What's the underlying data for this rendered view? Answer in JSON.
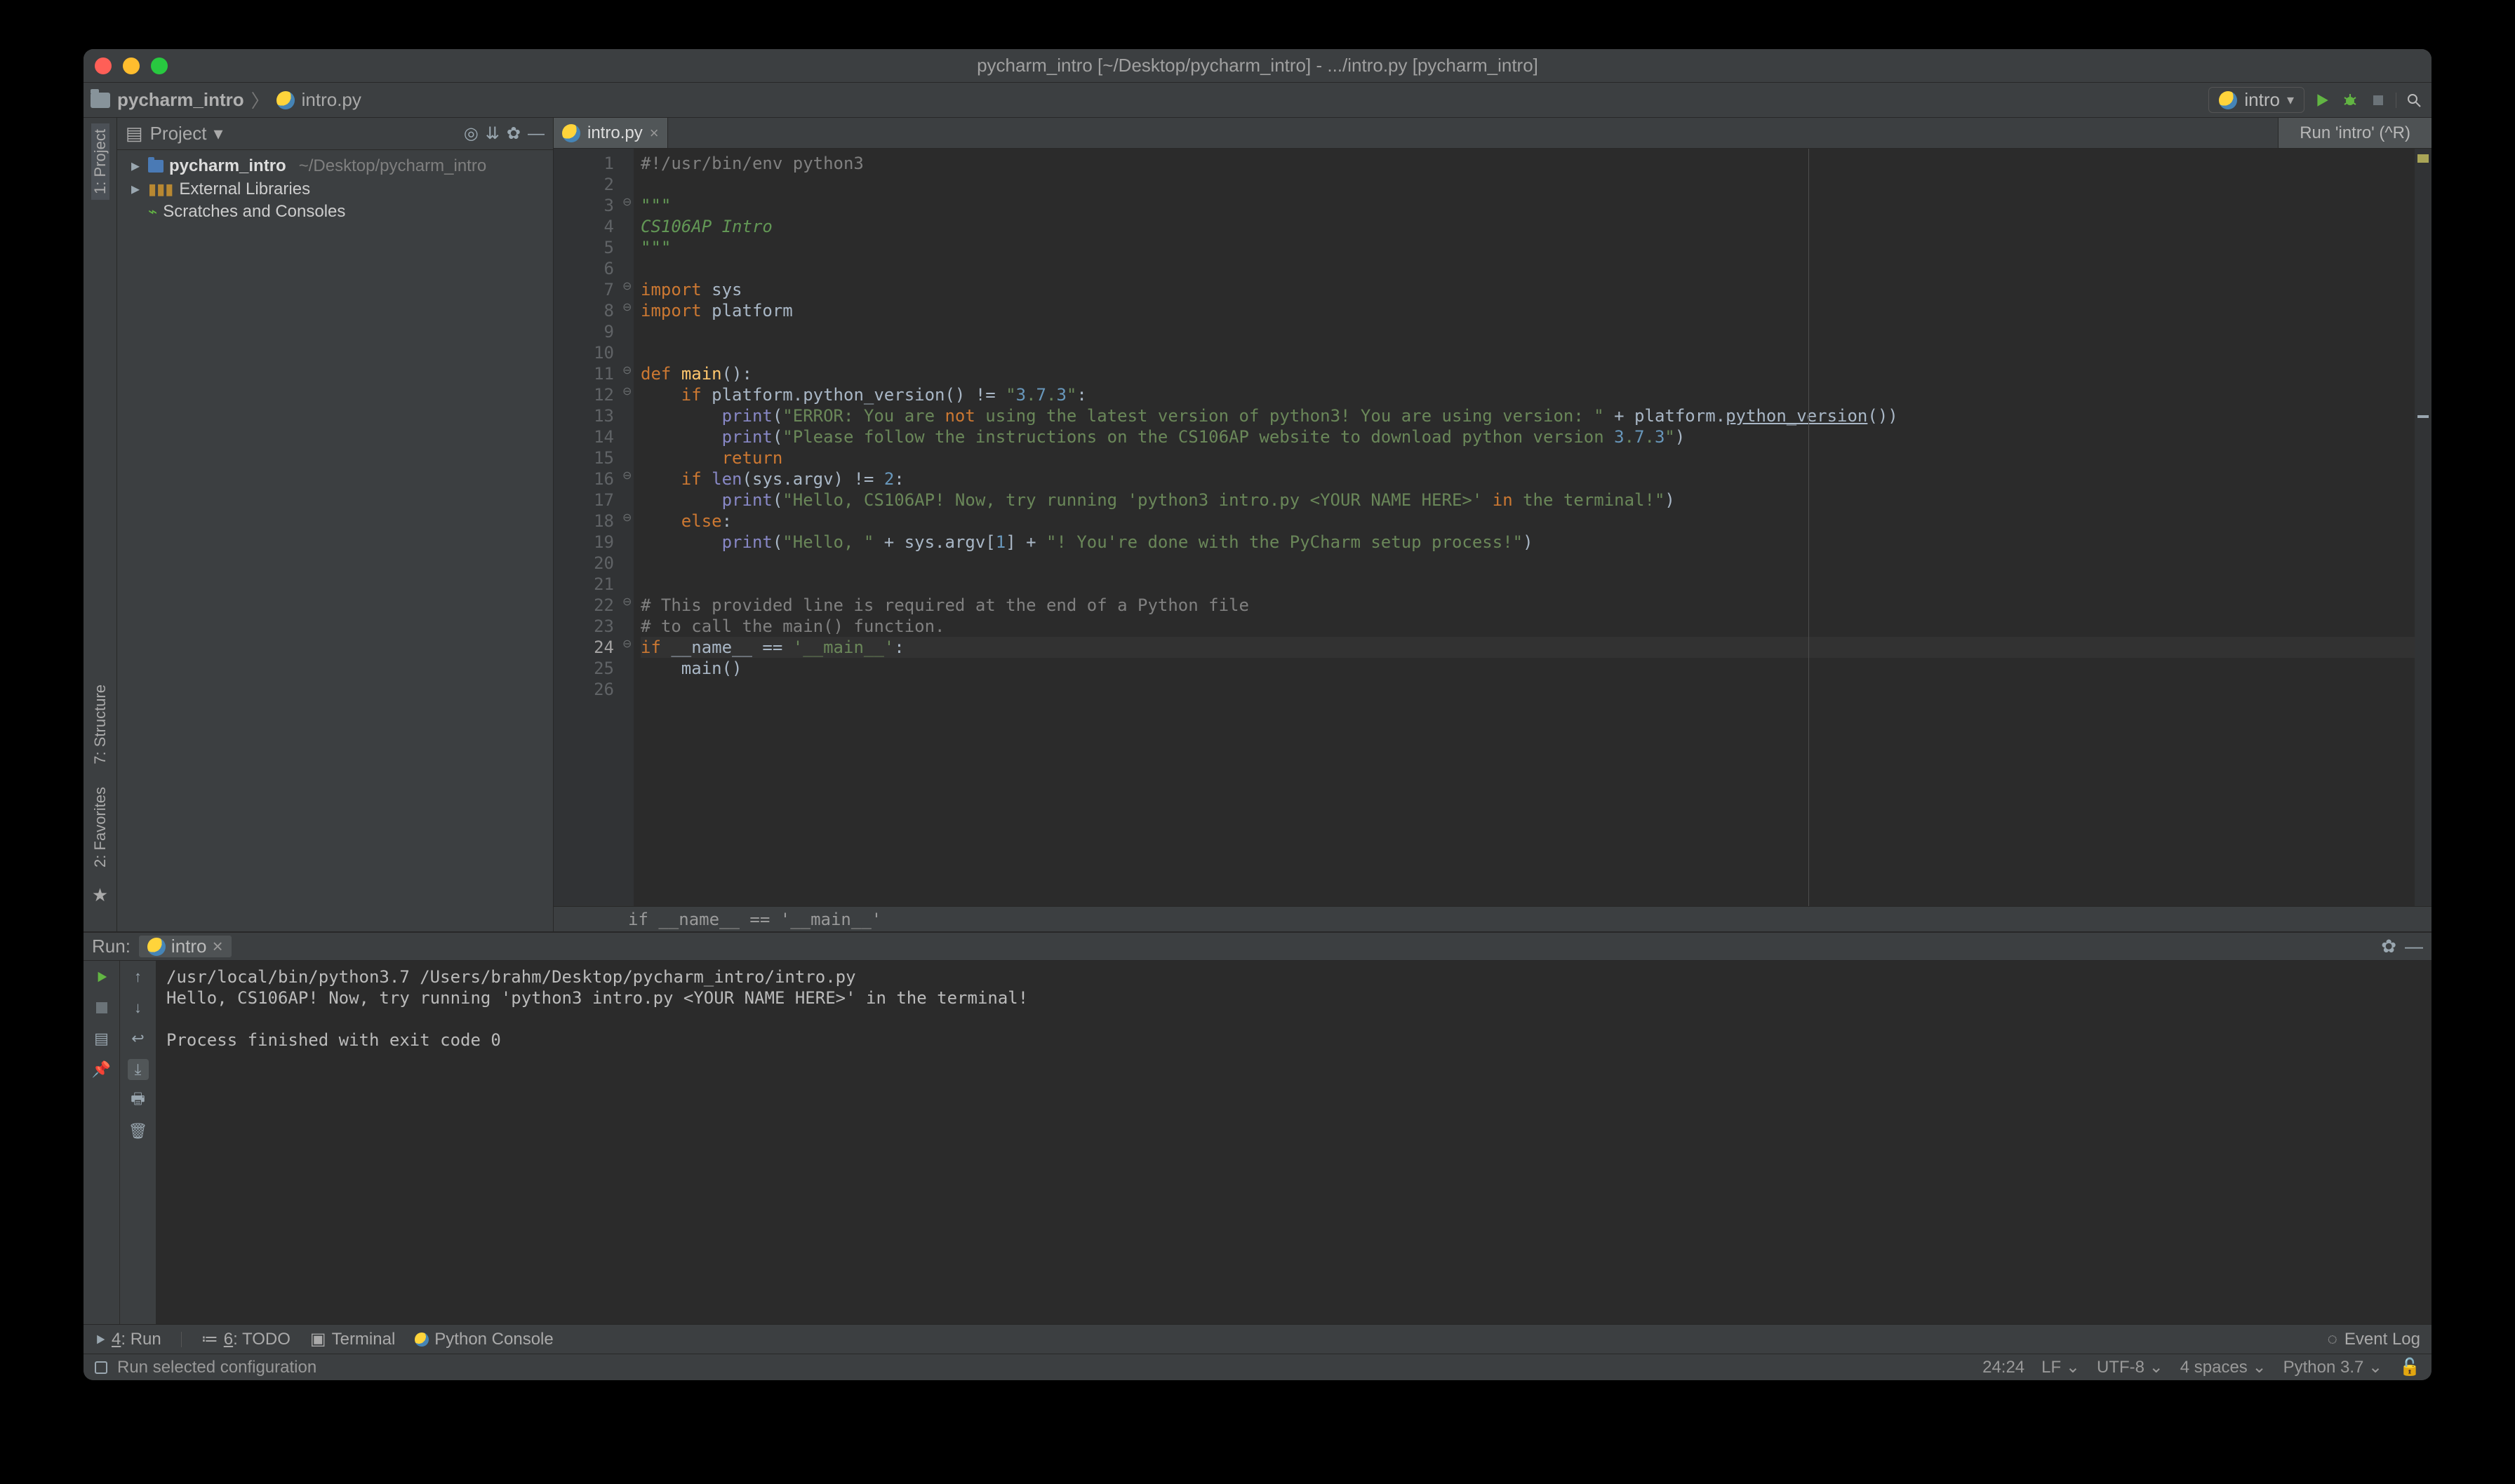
{
  "titlebar": {
    "title": "pycharm_intro [~/Desktop/pycharm_intro] - .../intro.py [pycharm_intro]"
  },
  "navbar": {
    "project_crumb": "pycharm_intro",
    "file_crumb": "intro.py",
    "run_config_label": "intro",
    "run_hint": "Run 'intro' (^R)"
  },
  "left_tabs": {
    "project": "1: Project",
    "structure": "7: Structure",
    "favorites": "2: Favorites"
  },
  "project_panel": {
    "header_label": "Project",
    "tree": {
      "root_name": "pycharm_intro",
      "root_path": "~/Desktop/pycharm_intro",
      "external_libs": "External Libraries",
      "scratches": "Scratches and Consoles"
    }
  },
  "editor": {
    "tab_label": "intro.py",
    "lines": [
      "#!/usr/bin/env python3",
      "",
      "\"\"\"",
      "CS106AP Intro",
      "\"\"\"",
      "",
      "import sys",
      "import platform",
      "",
      "",
      "def main():",
      "    if platform.python_version() != \"3.7.3\":",
      "        print(\"ERROR: You are not using the latest version of python3! You are using version: \" + platform.python_version())",
      "        print(\"Please follow the instructions on the CS106AP website to download python version 3.7.3\")",
      "        return",
      "    if len(sys.argv) != 2:",
      "        print(\"Hello, CS106AP! Now, try running 'python3 intro.py <YOUR NAME HERE>' in the terminal!\")",
      "    else:",
      "        print(\"Hello, \" + sys.argv[1] + \"! You're done with the PyCharm setup process!\")",
      "",
      "",
      "# This provided line is required at the end of a Python file",
      "# to call the main() function.",
      "if __name__ == '__main__':",
      "    main()",
      ""
    ],
    "current_line": 24,
    "breadcrumb": "if __name__ == '__main__'"
  },
  "run_panel": {
    "header_label": "Run:",
    "config_name": "intro",
    "console_lines": [
      "/usr/local/bin/python3.7 /Users/brahm/Desktop/pycharm_intro/intro.py",
      "Hello, CS106AP! Now, try running 'python3 intro.py <YOUR NAME HERE>' in the terminal!",
      "",
      "Process finished with exit code 0"
    ]
  },
  "bottom_bar": {
    "run": "Run",
    "run_u": "4",
    "todo": "TODO",
    "todo_u": "6",
    "terminal": "Terminal",
    "python_console": "Python Console",
    "event_log": "Event Log"
  },
  "status_bar": {
    "hint": "Run selected configuration",
    "pos": "24:24",
    "lf": "LF",
    "enc": "UTF-8",
    "indent": "4 spaces",
    "sdk": "Python 3.7"
  },
  "colors": {
    "bg": "#3c3f41",
    "editor_bg": "#2b2b2b",
    "green": "#62b543",
    "orange_kw": "#cc7832"
  }
}
